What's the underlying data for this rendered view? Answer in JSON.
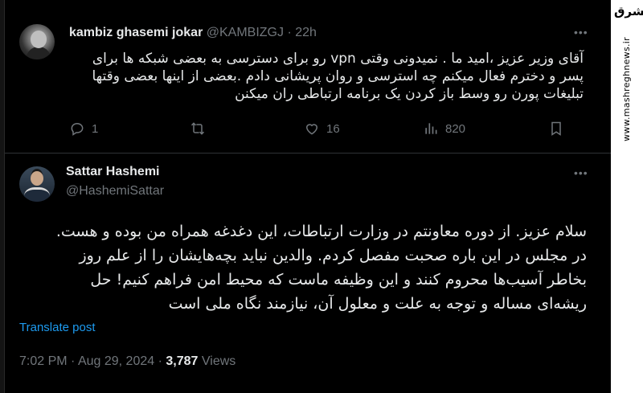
{
  "brand": {
    "logo_text": "مشرق",
    "url": "www.mashreghnews.ir"
  },
  "tweet1": {
    "author_name": "kambiz ghasemi jokar",
    "handle": "@KAMBIZGJ",
    "separator": "·",
    "time": "22h",
    "text_line1": "آقای وزیر عزیز ،امید ما . نمیدونی وقتی vpn رو برای دسترسی به بعضی شبکه ها برای",
    "text_line2": "پسر و دخترم فعال میکنم چه استرسی و روان پریشانی دادم .بعضی از اینها بعضی وقتها",
    "text_line3": "تبلیغات پورن رو وسط باز کردن یک برنامه ارتباطی ران میکنن",
    "replies": "1",
    "likes": "16",
    "views": "820"
  },
  "tweet2": {
    "author_name": "Sattar Hashemi",
    "handle": "@HashemiSattar",
    "text_line1": "سلام عزیز. از دوره معاونتم در وزارت ارتباطات، این دغدغه همراه من بوده و هست.",
    "text_line2": "در مجلس در این باره صحبت مفصل کردم. والدین نباید بچه‌هایشان را از علم روز",
    "text_line3": "بخاطر آسیب‌ها محروم کنند و این وظیفه ماست که محیط امن فراهم کنیم! حل",
    "text_line4": "ریشه‌ای مساله و توجه به علت و معلول آن، نیازمند نگاه ملی است",
    "translate_label": "Translate post",
    "time": "7:02 PM",
    "separator": "·",
    "date": "Aug 29, 2024",
    "views_count": "3,787",
    "views_label": "Views"
  },
  "icons": {
    "more": "more-dots-icon",
    "reply": "reply-bubble-icon",
    "retweet": "retweet-icon",
    "like": "heart-icon",
    "views": "analytics-bars-icon",
    "bookmark": "bookmark-icon"
  },
  "colors": {
    "background": "#000000",
    "text": "#e7e9ea",
    "muted": "#71767b",
    "link": "#1d9bf0",
    "divider": "#2f3336"
  }
}
